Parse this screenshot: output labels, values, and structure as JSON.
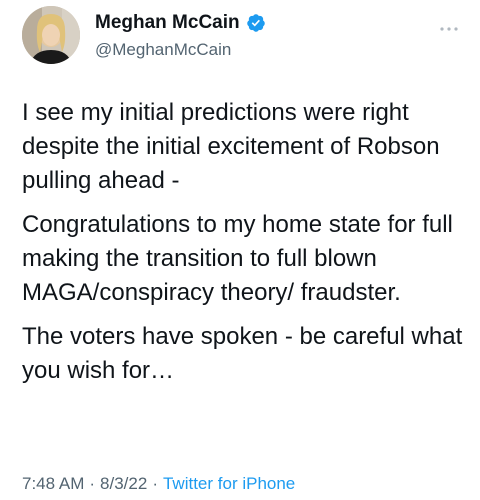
{
  "author": {
    "display_name": "Meghan McCain",
    "handle": "@MeghanMcCain",
    "verified": true
  },
  "tweet": {
    "paragraphs": [
      "I see my initial predictions were right despite the initial excitement of Robson pulling ahead -",
      "Congratulations to my home state for full making the transition to full blown MAGA/conspiracy theory/ fraudster.",
      "The voters have spoken - be careful what you wish for…"
    ],
    "time": "7:48 AM",
    "separator": "·",
    "date": "8/3/22",
    "source": "Twitter for iPhone"
  },
  "icons": {
    "verified": "verified-badge-icon",
    "more": "more-options-icon"
  },
  "colors": {
    "text": "#0f1419",
    "secondary": "#536471",
    "accent": "#1d9bf0"
  }
}
